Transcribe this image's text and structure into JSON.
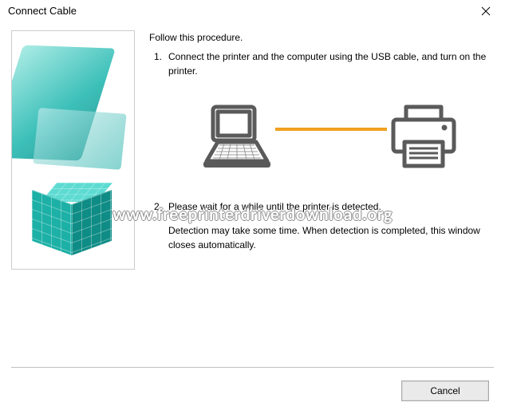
{
  "window": {
    "title": "Connect Cable"
  },
  "instructions": {
    "intro": "Follow this procedure.",
    "steps": [
      {
        "num": "1.",
        "text": "Connect the printer and the computer using the USB cable, and turn on the printer."
      },
      {
        "num": "2.",
        "text": "Please wait for a while until the printer is detected."
      }
    ],
    "note": "Detection may take some time. When detection is completed, this window closes automatically."
  },
  "footer": {
    "cancel_label": "Cancel"
  },
  "watermark": "www.freeprinterdriverdownload.org",
  "icons": {
    "laptop": "laptop-icon",
    "printer": "printer-icon",
    "close": "close-icon",
    "decor": "cube-decor-icon"
  },
  "colors": {
    "cable": "#f0a020",
    "icon_stroke": "#5a5a5a",
    "accent_teal": "#1cb0a6"
  }
}
